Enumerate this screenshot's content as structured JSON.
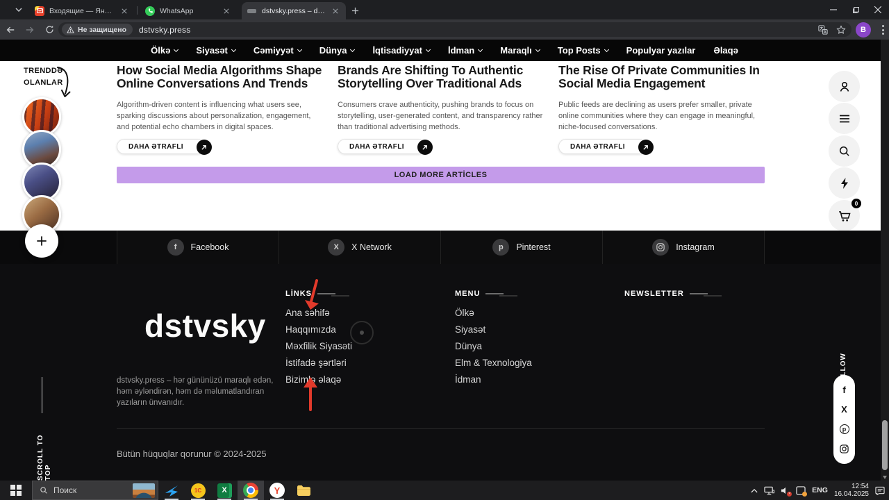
{
  "browser": {
    "tabs": [
      {
        "title": "Входящие — Яндекс Почта"
      },
      {
        "title": "WhatsApp"
      },
      {
        "title": "dstvsky.press – dstvsky.press –"
      }
    ],
    "security_chip": "Не защищено",
    "url": "dstvsky.press",
    "profile_initial": "B"
  },
  "site_nav": {
    "items": [
      {
        "label": "Ölkə"
      },
      {
        "label": "Siyasət"
      },
      {
        "label": "Cəmiyyət"
      },
      {
        "label": "Dünya"
      },
      {
        "label": "İqtisadiyyat"
      },
      {
        "label": "İdman"
      },
      {
        "label": "Maraqlı"
      },
      {
        "label": "Top Posts"
      },
      {
        "label": "Populyar yazılar"
      },
      {
        "label": "Əlaqə"
      }
    ]
  },
  "trending": {
    "line1": "TRENDDƏ",
    "line2": "OLANLAR"
  },
  "articles": [
    {
      "title": "How Social Media Algorithms Shape Online Conversations And Trends",
      "excerpt": "Algorithm-driven content is influencing what users see, sparking discussions about personalization, engagement, and potential echo chambers in digital spaces.",
      "cta": "DAHA ƏTRAFLI"
    },
    {
      "title": "Brands Are Shifting To Authentic Storytelling Over Traditional Ads",
      "excerpt": "Consumers crave authenticity, pushing brands to focus on storytelling, user-generated content, and transparency rather than traditional advertising methods.",
      "cta": "DAHA ƏTRAFLI"
    },
    {
      "title": "The Rise Of Private Communities In Social Media Engagement",
      "excerpt": "Public feeds are declining as users prefer smaller, private online communities where they can engage in meaningful, niche-focused conversations.",
      "cta": "DAHA ƏTRAFLI"
    }
  ],
  "load_more_label": "LOAD MORE ARTİCLES",
  "side_tools": {
    "cart_badge": "0"
  },
  "social_bar": {
    "items": [
      {
        "label": "Facebook"
      },
      {
        "label": "X Network"
      },
      {
        "label": "Pinterest"
      },
      {
        "label": "Instagram"
      }
    ]
  },
  "footer": {
    "logo": "dstvsky",
    "description": "dstvsky.press – hər gününüzü maraqlı edən, həm əyləndirən, həm də məlumatlandıran yazıların ünvanıdır.",
    "links": {
      "heading": "LİNKS",
      "items": [
        "Ana səhifə",
        "Haqqımızda",
        "Məxfilik Siyasəti",
        "İstifadə şərtləri",
        "Bizimlə əlaqə"
      ]
    },
    "menu": {
      "heading": "MENU",
      "items": [
        "Ölkə",
        "Siyasət",
        "Dünya",
        "Elm & Texnologiya",
        "İdman"
      ]
    },
    "newsletter": {
      "heading": "NEWSLETTER"
    },
    "copyright": "Bütün hüquqlar qorunur © 2024-2025",
    "follow": "FOLLOW",
    "scroll_to_top": "SCROLL TO TOP"
  },
  "taskbar": {
    "search_placeholder": "Поиск",
    "language": "ENG",
    "time": "12:54",
    "date": "16.04.2025"
  },
  "glyphs": {
    "facebook": "f",
    "x_network": "X",
    "pinterest": "p",
    "yandex_browser": "Y",
    "one_c": "1С",
    "excel": "X"
  },
  "colors": {
    "accent_purple": "#c49bea",
    "annotation_red": "#e23a2b",
    "profile_avatar": "#8a46c9",
    "whatsapp_green": "#35cc5a",
    "cart_badge_bg": "#000000"
  }
}
